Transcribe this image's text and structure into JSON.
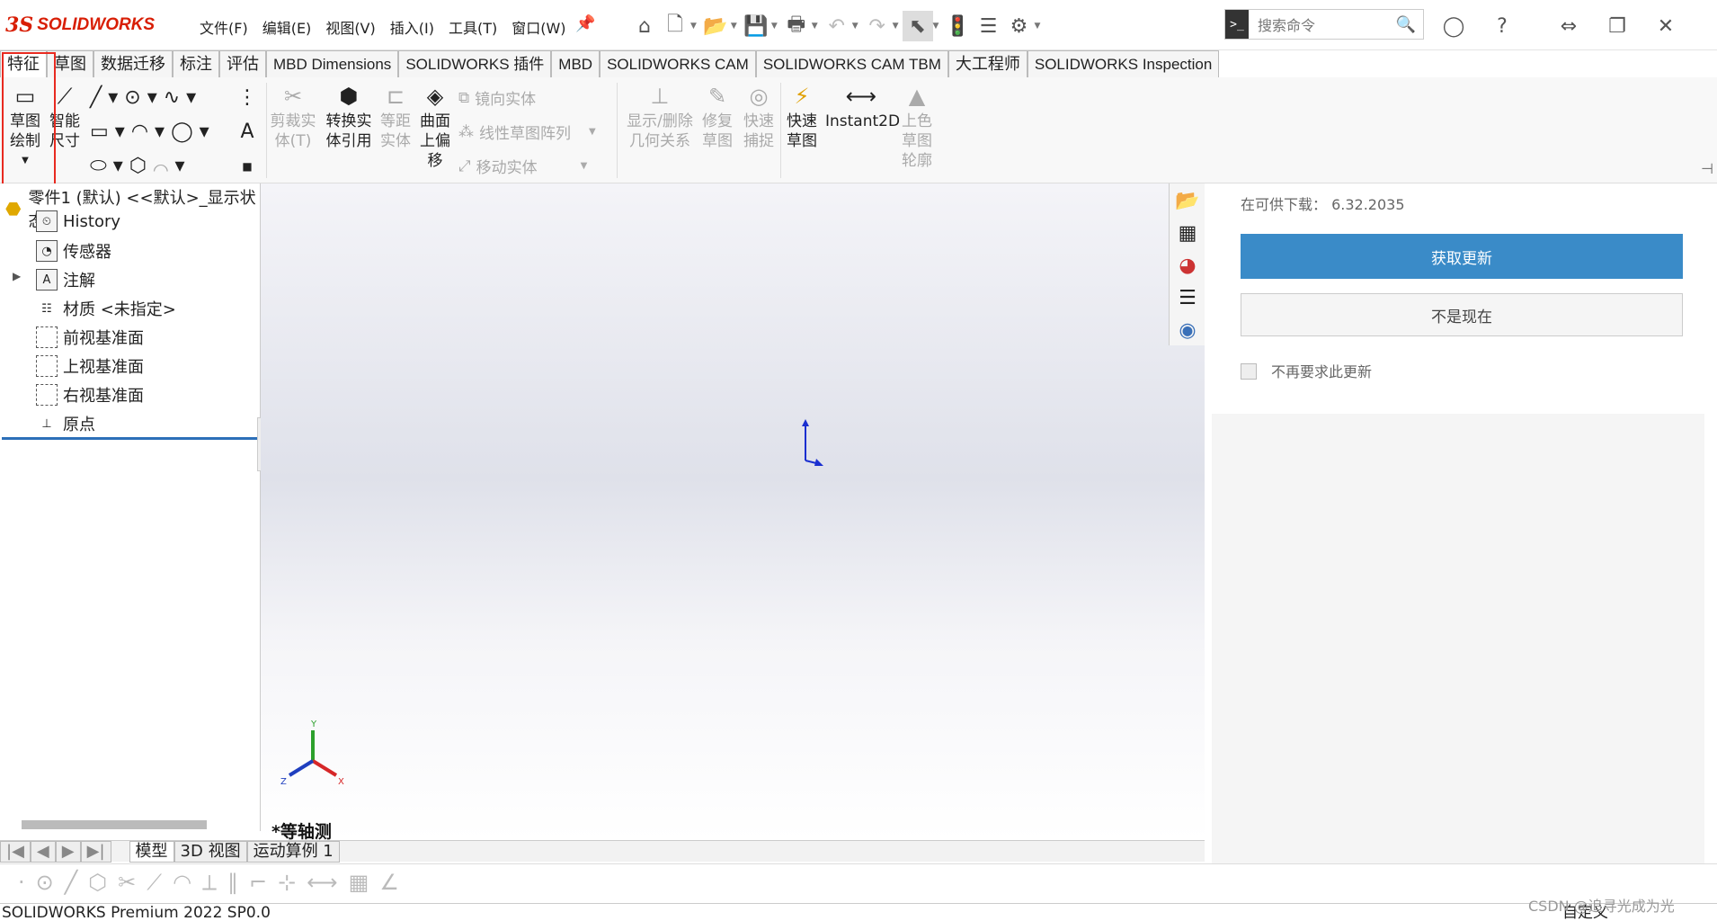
{
  "app": {
    "logo_ds": "3S",
    "logo_text": "SOLIDWORKS"
  },
  "menu": [
    "文件(F)",
    "编辑(E)",
    "视图(V)",
    "插入(I)",
    "工具(T)",
    "窗口(W)"
  ],
  "search": {
    "placeholder": "搜索命令"
  },
  "tabs": [
    "特征",
    "草图",
    "数据迁移",
    "标注",
    "评估",
    "MBD Dimensions",
    "SOLIDWORKS 插件",
    "MBD",
    "SOLIDWORKS CAM",
    "SOLIDWORKS CAM TBM",
    "大工程师",
    "SOLIDWORKS Inspection"
  ],
  "ribbon": {
    "sketch": [
      "草图",
      "绘制"
    ],
    "smart_dim": [
      "智能",
      "尺寸"
    ],
    "trim": [
      "剪裁实",
      "体(T)"
    ],
    "convert": [
      "转换实",
      "体引用"
    ],
    "offset": [
      "等距",
      "实体"
    ],
    "surface_offset": [
      "曲面",
      "上偏",
      "移"
    ],
    "mirror": "镜向实体",
    "linear_pattern": "线性草图阵列",
    "move": "移动实体",
    "relations": [
      "显示/删除",
      "几何关系"
    ],
    "repair": [
      "修复",
      "草图"
    ],
    "snap": [
      "快速",
      "捕捉"
    ],
    "quick_sketch": [
      "快速",
      "草图"
    ],
    "instant2d": "Instant2D",
    "shaded": [
      "上色",
      "草图",
      "轮廓"
    ]
  },
  "tree": {
    "root": "零件1 (默认) <<默认>_显示状态",
    "items": [
      "History",
      "传感器",
      "注解",
      "材质 <未指定>",
      "前视基准面",
      "上视基准面",
      "右视基准面",
      "原点"
    ]
  },
  "update": {
    "available": "在可供下载： 6.32.2035",
    "primary": "获取更新",
    "secondary": "不是现在",
    "checkbox": "不再要求此更新"
  },
  "view_label": "*等轴测",
  "triad": {
    "x": "X",
    "y": "Y",
    "z": "Z"
  },
  "view_tabs": [
    "模型",
    "3D 视图",
    "运动算例 1"
  ],
  "status": {
    "text": "SOLIDWORKS Premium 2022 SP0.0",
    "right": "自定义"
  },
  "watermark": "CSDN @追寻光成为光",
  "colors": {
    "brand_red": "#d81e05",
    "primary_button": "#3a8bc8",
    "annotation_red": "#e82a20"
  }
}
